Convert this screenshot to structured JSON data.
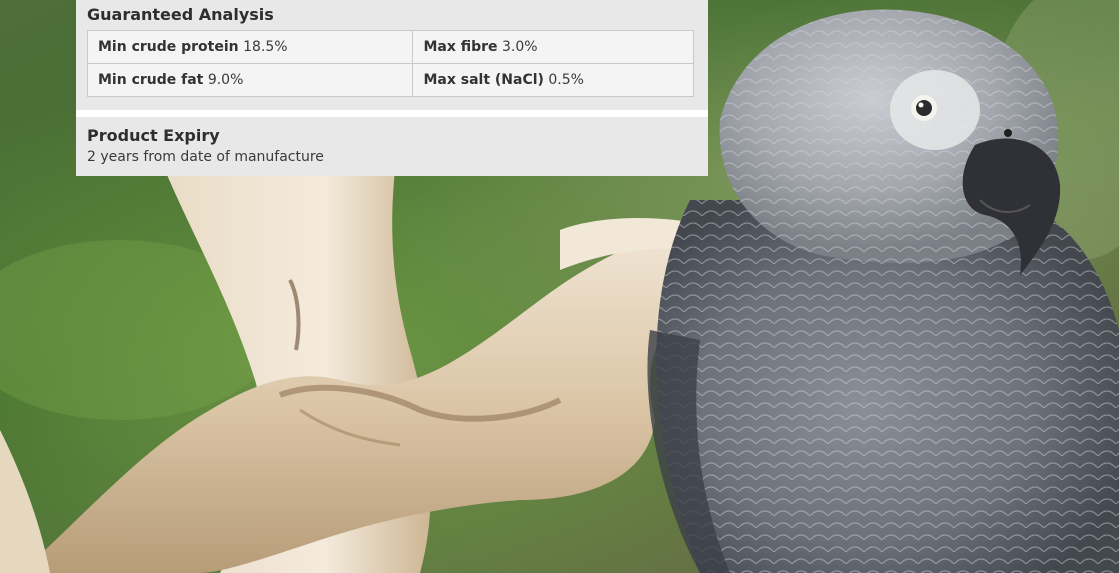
{
  "analysis": {
    "title": "Guaranteed Analysis",
    "rows": [
      [
        {
          "label": "Min crude protein",
          "value": "18.5%"
        },
        {
          "label": "Max fibre",
          "value": "3.0%"
        }
      ],
      [
        {
          "label": "Min crude fat",
          "value": "9.0%"
        },
        {
          "label": "Max salt (NaCl)",
          "value": "0.5%"
        }
      ]
    ]
  },
  "expiry": {
    "title": "Product Expiry",
    "text": "2 years from date of manufacture"
  },
  "colors": {
    "panel_bg": "#e8e8e8",
    "cell_border": "#c9c9c9",
    "text": "#2b2b2b"
  }
}
